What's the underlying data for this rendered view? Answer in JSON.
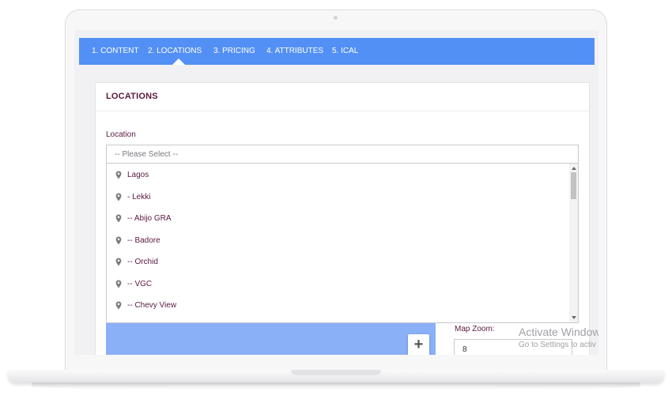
{
  "tabs": [
    {
      "label": "1. CONTENT"
    },
    {
      "label": "2. LOCATIONS"
    },
    {
      "label": "3. PRICING"
    },
    {
      "label": "4. ATTRIBUTES"
    },
    {
      "label": "5. ICAL"
    }
  ],
  "active_tab": "2. LOCATIONS",
  "panel": {
    "title": "LOCATIONS"
  },
  "location": {
    "label": "Location",
    "placeholder": "-- Please Select --",
    "options": [
      {
        "label": "Lagos"
      },
      {
        "label": "- Lekki"
      },
      {
        "label": "-- Abijo GRA"
      },
      {
        "label": "-- Badore"
      },
      {
        "label": "-- Orchid"
      },
      {
        "label": "-- VGC"
      },
      {
        "label": "-- Chevy View"
      }
    ]
  },
  "map": {
    "zoom_in_label": "+"
  },
  "map_zoom": {
    "label": "Map Zoom:",
    "value": "8"
  },
  "watermark": {
    "line1": "Activate Window",
    "line2": "Go to Settings to activ"
  },
  "colors": {
    "tab_bar": "#5390f5",
    "text_accent": "#5a1840",
    "map": "#8ab0f7"
  }
}
